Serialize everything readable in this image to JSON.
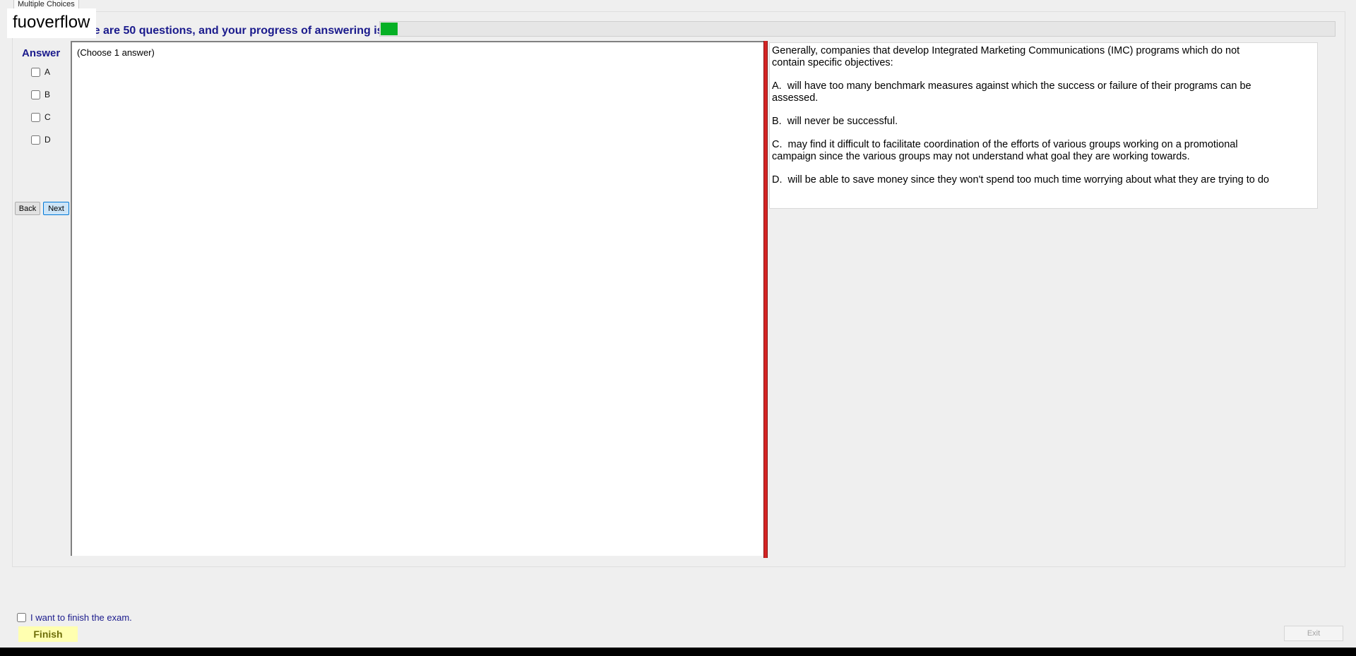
{
  "tab": {
    "label": "Multiple Choices"
  },
  "watermark": "fuoverflow",
  "progress": {
    "label": "There are 50 questions, and your progress of answering is",
    "fraction": 0.018,
    "fill_color": "#06b025"
  },
  "answer": {
    "title": "Answer",
    "options": [
      {
        "label": "A",
        "checked": false
      },
      {
        "label": "B",
        "checked": false
      },
      {
        "label": "C",
        "checked": false
      },
      {
        "label": "D",
        "checked": false
      }
    ]
  },
  "nav": {
    "back_label": "Back",
    "next_label": "Next"
  },
  "left_pane": {
    "hint": "(Choose 1 answer)"
  },
  "question": {
    "stem": "Generally, companies that develop Integrated Marketing Communications (IMC) programs which do not\ncontain specific objectives:",
    "choices": [
      "A.  will have too many benchmark measures against which the success or failure of their programs can be\nassessed.",
      "B.  will never be successful.",
      "C.  may find it difficult to facilitate coordination of the efforts of various groups working on a promotional\ncampaign since the various groups may not understand what goal they are working towards.",
      "D.  will be able to save money since they won't spend too much time worrying about what they are trying to do"
    ]
  },
  "footer": {
    "finish_checkbox_label": "I want to finish the exam.",
    "finish_label": "Finish",
    "exit_label": "Exit"
  },
  "colors": {
    "accent_text": "#1a1a8c",
    "splitter": "#d42525",
    "finish_bg": "#ffffb0"
  }
}
